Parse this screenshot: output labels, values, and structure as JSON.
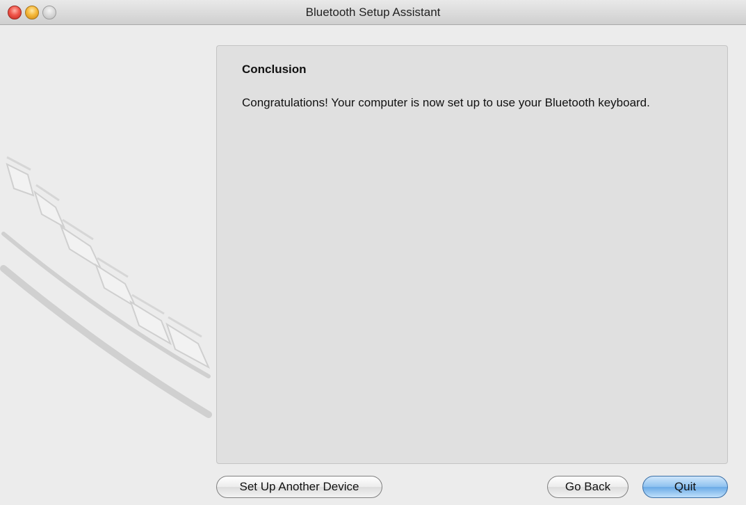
{
  "window": {
    "title": "Bluetooth Setup Assistant"
  },
  "content": {
    "heading": "Conclusion",
    "message": "Congratulations! Your computer is now set up to use your Bluetooth keyboard."
  },
  "buttons": {
    "setup_another": "Set Up Another Device",
    "go_back": "Go Back",
    "quit": "Quit"
  },
  "icons": {
    "close": "close-icon",
    "minimize": "minimize-icon",
    "zoom": "zoom-icon",
    "decoration": "keyboard-illustration"
  },
  "colors": {
    "default_button": "#6aaae6",
    "panel": "#e0e0e0",
    "window": "#ececec"
  }
}
